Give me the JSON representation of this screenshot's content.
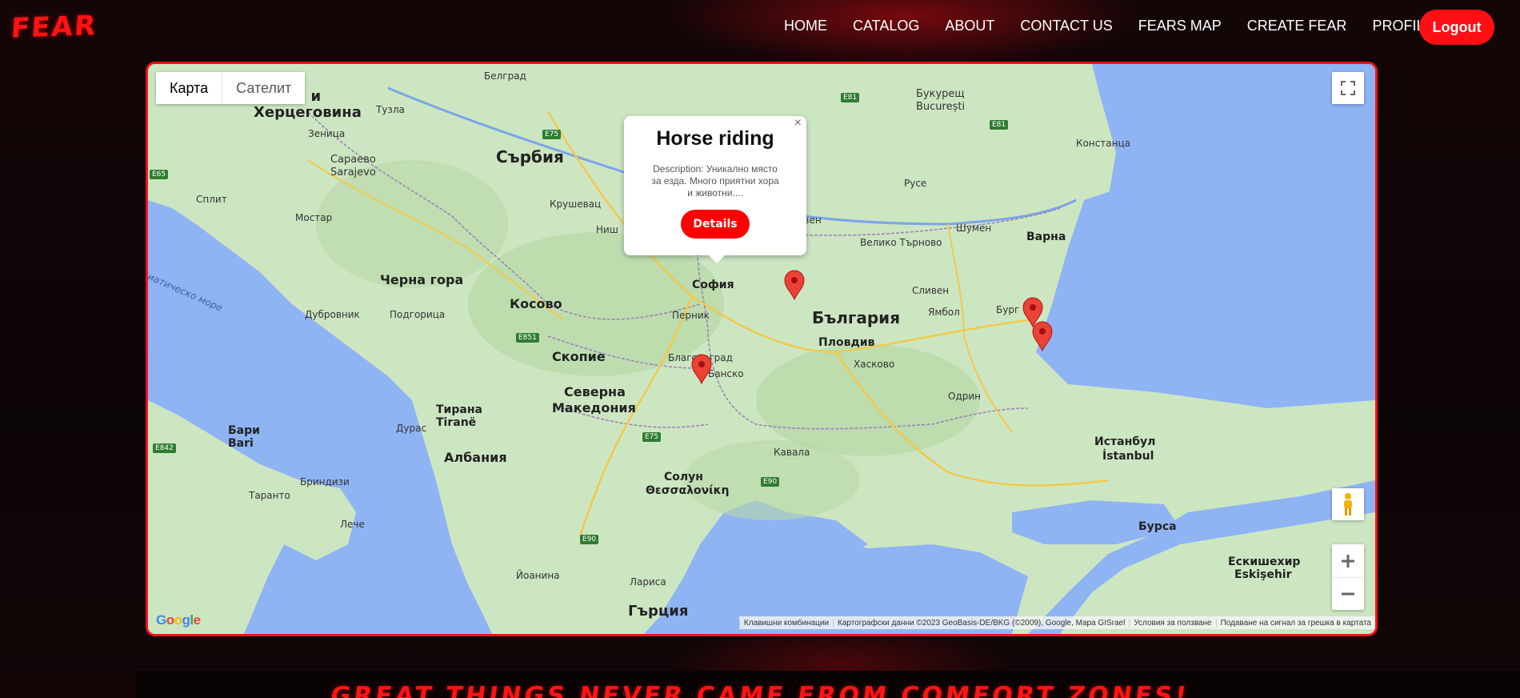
{
  "brand": {
    "logo": "FEAR"
  },
  "nav": {
    "links": [
      "HOME",
      "CATALOG",
      "ABOUT",
      "CONTACT US",
      "FEARS MAP",
      "CREATE FEAR",
      "PROFILE"
    ],
    "logout": "Logout"
  },
  "map": {
    "map_types": {
      "map": "Карта",
      "satellite": "Сателит"
    },
    "labels": {
      "belgrade": "Белград",
      "bucharest": "Букурещ",
      "bucuresti": "București",
      "serbia": "Сърбия",
      "bosnia": "сна и",
      "herzegovina": "Херцеговина",
      "sarajevo": "Сараево",
      "sarajevo_latin": "Sarajevo",
      "montenegro": "Черна гора",
      "kosovo": "Косово",
      "bulgaria": "България",
      "sofia": "София",
      "plovdiv": "Пловдив",
      "varna": "Варна",
      "burgas": "Бург",
      "pleven": "евен",
      "veliko_tarnovo": "Велико Търново",
      "ruse": "Русе",
      "shumen": "Шумен",
      "sliven": "Сливен",
      "yambol": "Ямбол",
      "haskovo": "Хасково",
      "pernik": "Перник",
      "blagoevgrad": "Благоевград",
      "bansko": "Банско",
      "skopje": "Скопие",
      "north_macedonia_1": "Северна",
      "north_macedonia_2": "Македония",
      "tirana": "Тирана",
      "tirana_latin": "Tiranë",
      "albania": "Албания",
      "thessaloniki": "Солун",
      "thessaloniki_greek": "Θεσσαλονίκη",
      "greece": "Гърция",
      "istanbul": "Истанбул",
      "istanbul_latin": "İstanbul",
      "bursa": "Бурса",
      "eskisehir": "Ескишехир",
      "eskisehir_latin": "Eskişehir",
      "bari": "Бари",
      "bari_latin": "Bari",
      "taranto": "Таранто",
      "brindisi": "Бриндизи",
      "lecce": "Лече",
      "split": "Сплит",
      "dubrovnik": "Дубровник",
      "constanta": "Констанца",
      "edirne": "Одрин",
      "kavala": "Кавала",
      "adriatic_sea": "иатическо море",
      "nis": "Ниш",
      "kragujevac": "Крушевац",
      "larisa": "Лариса",
      "ioannina": "Йоанина",
      "durres": "Дурас",
      "mostar": "Мостар",
      "podgorica": "Подгорица",
      "zenica": "Зеница",
      "tuzla": "Тузла"
    },
    "highways": [
      "E65",
      "E75",
      "E851",
      "E842",
      "E81",
      "E90",
      "E90",
      "E75",
      "E81"
    ],
    "markers": [
      {
        "name": "Horse riding"
      },
      {
        "name": "marker-2"
      },
      {
        "name": "marker-3"
      },
      {
        "name": "marker-4"
      }
    ],
    "popup": {
      "title": "Horse riding",
      "description": "Description: Уникално място за езда. Много приятни хора и животни....",
      "button": "Details",
      "close": "×"
    },
    "google_logo": "Google",
    "attribution": [
      "Клавишни комбинации",
      "Картографски данни ©2023 GeoBasis-DE/BKG (©2009), Google, Mapa GISrael",
      "Условия за ползване",
      "Подаване на сигнал за грешка в картата"
    ],
    "colors": {
      "land": "#cde6c2",
      "water": "#8fb4f4",
      "border": "#ff0f14",
      "marker": "#ea4335"
    }
  },
  "footer": {
    "tagline": "GREAT THINGS NEVER CAME FROM COMFORT ZONES!"
  }
}
